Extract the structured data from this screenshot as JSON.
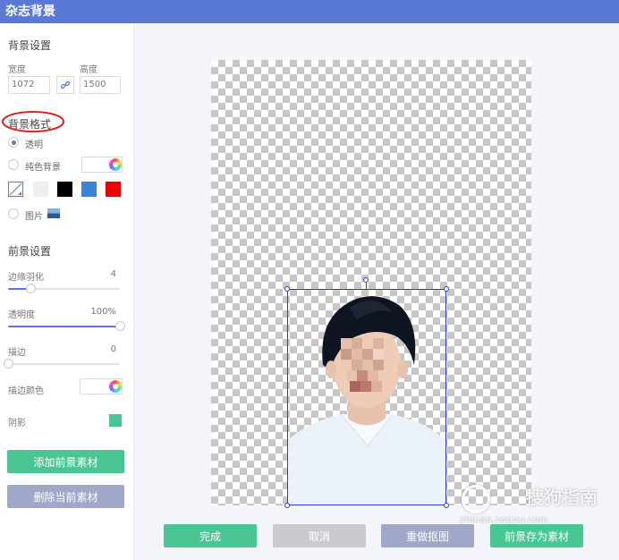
{
  "window": {
    "title": "杂志背景"
  },
  "background_settings": {
    "title": "背景设置",
    "width_label": "宽度",
    "height_label": "高度",
    "width_value": "1072",
    "height_value": "1500",
    "link_icon": "link-icon"
  },
  "background_format": {
    "title": "背景格式",
    "options": [
      {
        "label": "透明",
        "checked": true
      },
      {
        "label": "纯色背景",
        "checked": false
      },
      {
        "label": "图片",
        "checked": false
      }
    ],
    "swatch_colors": [
      "transparent",
      "#eeeeee",
      "#000000",
      "#3a86d6",
      "#ee0000"
    ]
  },
  "foreground_settings": {
    "title": "前景设置",
    "edge_feather": {
      "label": "边缘羽化",
      "value": "4",
      "fraction": 0.2
    },
    "opacity": {
      "label": "透明度",
      "value": "100%",
      "fraction": 1.0
    },
    "stroke": {
      "label": "描边",
      "value": "0",
      "fraction": 0.0
    },
    "stroke_color_label": "描边颜色",
    "shadow_label": "阴影",
    "shadow_color": "#4ac694"
  },
  "sidebar_buttons": {
    "add_foreground": "添加前景素材",
    "delete_foreground": "删除当前素材"
  },
  "bottom_buttons": {
    "done": "完成",
    "cancel": "取消",
    "redo_cutout": "重做抠图",
    "save_foreground": "前景存为素材"
  },
  "watermark": {
    "brand": "搜狗指南",
    "url": "zhinan.sogou.com"
  },
  "colors": {
    "accent": "#5a78d6",
    "green": "#4ac694",
    "gray_button": "#c9cbd1",
    "slate_button": "#a1a7c9",
    "annotation_red": "#e02020"
  }
}
